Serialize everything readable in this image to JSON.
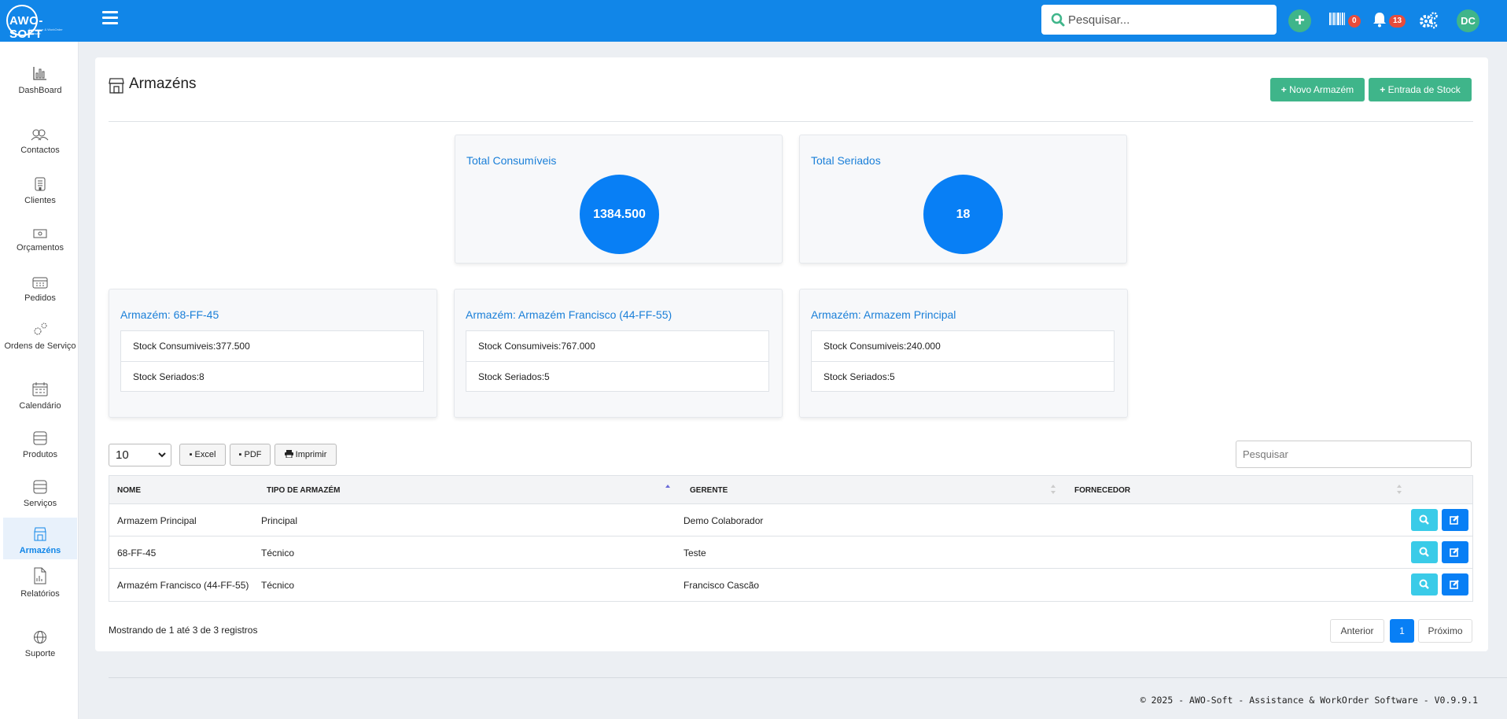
{
  "app": {
    "logo_text": "AWO-SOFT",
    "logo_tagline": "Assistance & WorkOrder Software"
  },
  "header": {
    "search_placeholder": "Pesquisar...",
    "barcode_badge": "0",
    "notifications_badge": "13",
    "user_initials": "DC",
    "accent_color": "#1186e8"
  },
  "sidebar": {
    "items": [
      {
        "label": "DashBoard",
        "icon": "bar-chart-icon"
      },
      {
        "label": "Contactos",
        "icon": "people-icon"
      },
      {
        "label": "Clientes",
        "icon": "building-icon"
      },
      {
        "label": "Orçamentos",
        "icon": "money-icon"
      },
      {
        "label": "Pedidos",
        "icon": "calendar-grid-icon"
      },
      {
        "label": "Ordens de Serviço",
        "icon": "gears-icon"
      },
      {
        "label": "Calendário",
        "icon": "calendar-icon"
      },
      {
        "label": "Produtos",
        "icon": "database-icon"
      },
      {
        "label": "Serviços",
        "icon": "database-icon"
      },
      {
        "label": "Armazéns",
        "icon": "warehouse-icon",
        "active": true
      },
      {
        "label": "Relatórios",
        "icon": "report-icon"
      },
      {
        "label": "Suporte",
        "icon": "globe-icon"
      }
    ]
  },
  "page": {
    "title": "Armazéns",
    "new_warehouse_button": "Novo Armazém",
    "stock_entry_button": "Entrada de Stock"
  },
  "totals": {
    "consumables": {
      "title": "Total Consumíveis",
      "value": "1384.500"
    },
    "serialized": {
      "title": "Total Seriados",
      "value": "18"
    }
  },
  "warehouses": [
    {
      "title": "Armazém: 68-FF-45",
      "consumables": "Stock Consumiveis:377.500",
      "serialized": "Stock Seriados:8"
    },
    {
      "title": "Armazém: Armazém Francisco (44-FF-55)",
      "consumables": "Stock Consumiveis:767.000",
      "serialized": "Stock Seriados:5"
    },
    {
      "title": "Armazém: Armazem Principal",
      "consumables": "Stock Consumiveis:240.000",
      "serialized": "Stock Seriados:5"
    }
  ],
  "table_controls": {
    "page_size": "10",
    "excel": "Excel",
    "pdf": "PDF",
    "print": "Imprimir",
    "search_placeholder": "Pesquisar"
  },
  "table": {
    "columns": [
      "NOME",
      "TIPO DE ARMAZÉM",
      "GERENTE",
      "FORNECEDOR"
    ],
    "rows": [
      {
        "name": "Armazem Principal",
        "type": "Principal",
        "manager": "Demo Colaborador",
        "supplier": ""
      },
      {
        "name": "68-FF-45",
        "type": "Técnico",
        "manager": "Teste",
        "supplier": ""
      },
      {
        "name": "Armazém Francisco (44-FF-55)",
        "type": "Técnico",
        "manager": "Francisco Cascão",
        "supplier": ""
      }
    ],
    "view_button_color": "#3acbe8",
    "edit_button_color": "#087ff5"
  },
  "pagination": {
    "info": "Mostrando de 1 até 3 de 3 registros",
    "previous": "Anterior",
    "current": "1",
    "next": "Próximo"
  },
  "footer": {
    "text": "© 2025 - AWO-Soft - Assistance & WorkOrder Software - V0.9.9.1"
  }
}
